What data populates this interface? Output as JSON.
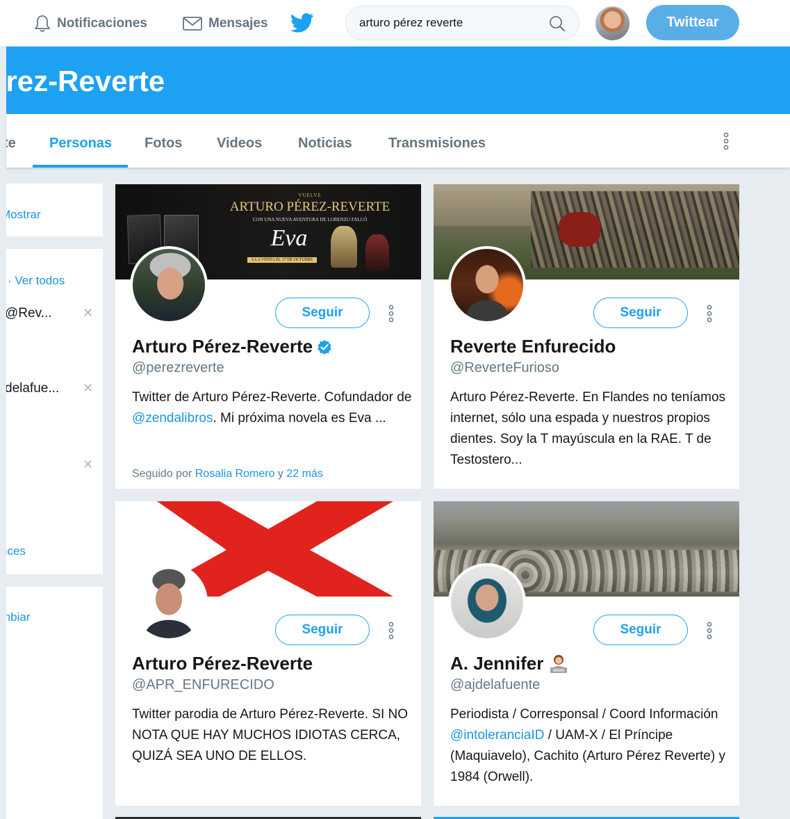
{
  "topbar": {
    "notifications_label": "Notificaciones",
    "messages_label": "Mensajes",
    "search_value": "arturo pérez reverte",
    "tweet_button": "Twittear"
  },
  "banner": {
    "title": "Pérez-Reverte"
  },
  "tabs": {
    "partial": "te",
    "items": [
      "Personas",
      "Fotos",
      "Videos",
      "Noticias",
      "Transmisiones"
    ],
    "active": "Personas"
  },
  "sidebar": {
    "show_link": "Mostrar",
    "see_all": "· Ver todos",
    "suggestion_1": "@Rev...",
    "suggestion_2": "delafue...",
    "partial_link": "nces",
    "change_link": "mbiar"
  },
  "cards": [
    {
      "cover_heading": "VUELVE",
      "cover_title": "ARTURO PÉREZ-REVERTE",
      "cover_subtitle": "CON UNA NUEVA AVENTURA DE LORENZO FALCÓ",
      "cover_book": "Eva",
      "cover_release": "A LA VENTA EL 17 DE OCTUBRE",
      "follow": "Seguir",
      "name": "Arturo Pérez-Reverte",
      "handle": "@perezreverte",
      "bio_pre": "Twitter de Arturo Pérez-Reverte. Cofundador de ",
      "bio_link": "@zendalibros",
      "bio_post": ". Mi próxima novela es Eva ...",
      "followed_prefix": "Seguido por ",
      "followed_by": "Rosalia Romero",
      "followed_mid": " y ",
      "followed_more": "22 más"
    },
    {
      "follow": "Seguir",
      "name": "Reverte Enfurecido",
      "handle": "@ReverteFurioso",
      "bio": "Arturo Pérez-Reverte. En Flandes no teníamos internet, sólo una espada y nuestros propios dientes. Soy la T mayúscula en la RAE. T de Testostero..."
    },
    {
      "follow": "Seguir",
      "name": "Arturo Pérez-Reverte",
      "handle": "@APR_ENFURECIDO",
      "bio": "Twitter parodia de Arturo Pérez-Reverte. SI NO NOTA QUE HAY MUCHOS IDIOTAS CERCA, QUIZÁ SEA UNO DE ELLOS."
    },
    {
      "follow": "Seguir",
      "name": "A. Jennifer",
      "handle": "@ajdelafuente",
      "bio_pre": "Periodista / Corresponsal / Coord Información ",
      "bio_link": "@intoleranciaID",
      "bio_post": " / UAM-X / El Príncipe (Maquiavelo), Cachito (Arturo Pérez Reverte) y 1984 (Orwell)."
    }
  ],
  "colors": {
    "accent": "#1da1f2",
    "link": "#1b95e0",
    "tweet_button": "#5aaee8",
    "muted": "#657786"
  }
}
